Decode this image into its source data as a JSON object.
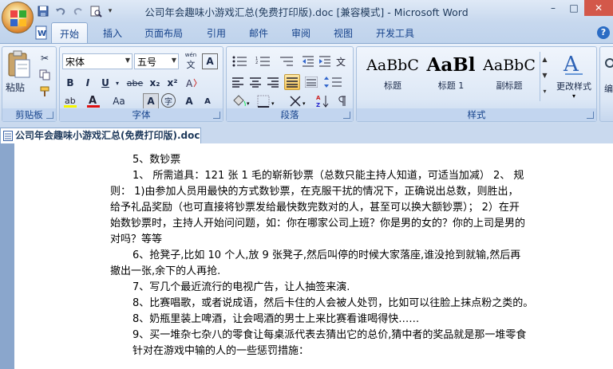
{
  "window": {
    "title": "公司年会趣味小游戏汇总(免费打印版).doc [兼容模式] - Microsoft Word",
    "controls": [
      "–",
      "□",
      "✕"
    ]
  },
  "tabs": [
    "开始",
    "插入",
    "页面布局",
    "引用",
    "邮件",
    "审阅",
    "视图",
    "开发工具"
  ],
  "ribbon": {
    "clipboard": {
      "label": "剪贴板",
      "paste_label": "粘贴"
    },
    "font": {
      "label": "字体",
      "font_name": "宋体",
      "font_size": "五号",
      "wen": "wén",
      "bold": "B",
      "italic": "I",
      "underline": "U",
      "strike": "abe",
      "sub": "x₂",
      "sup": "x²",
      "aa": "Aa",
      "a_box": "A",
      "a_circle": "字",
      "grow": "A",
      "shrink": "A"
    },
    "paragraph": {
      "label": "段落"
    },
    "styles": {
      "label": "样式",
      "items": [
        {
          "sample": "AaBbC",
          "name": "标题"
        },
        {
          "sample": "AaBl",
          "name": "标题 1"
        },
        {
          "sample": "AaBbC",
          "name": "副标题"
        }
      ],
      "change_styles": "更改样式"
    },
    "editing_partial": "编"
  },
  "document_tab": "公司年会趣味小游戏汇总(免费打印版).doc",
  "document": {
    "lines": [
      "5、数钞票",
      "1、  所需道具：121 张 1 毛的崭新钞票（总数只能主持人知道，可适当加减） 2、  规",
      "则： 1)由参加人员用最快的方式数钞票，在克服干扰的情况下，正确说出总数，则胜出，",
      "给予礼品奖励（也可直接将钞票发给最快数完数对的人，甚至可以换大额钞票）； 2）在开",
      "始数钞票时，主持人开始问问题，如：你在哪家公司上班？你是男的女的？你的上司是男的",
      "对吗？等等",
      "6、抢凳子,比如 10 个人,放 9 张凳子,然后叫停的时候大家落座,谁没抢到就输,然后再",
      "撤出一张,余下的人再抢.",
      "7、写几个最近流行的电视广告，让人抽签来演.",
      "8、比赛唱歌，或者说成语，然后卡住的人会被人处罚，比如可以往脸上抹点粉之类的。",
      "8、奶瓶里装上啤酒，让会喝酒的男士上来比赛看谁喝得快……",
      "9、买一堆杂七杂八的零食让每桌派代表去猜出它的总价,猜中者的奖品就是那一堆零食",
      "针对在游戏中输的人的一些惩罚措施："
    ]
  }
}
